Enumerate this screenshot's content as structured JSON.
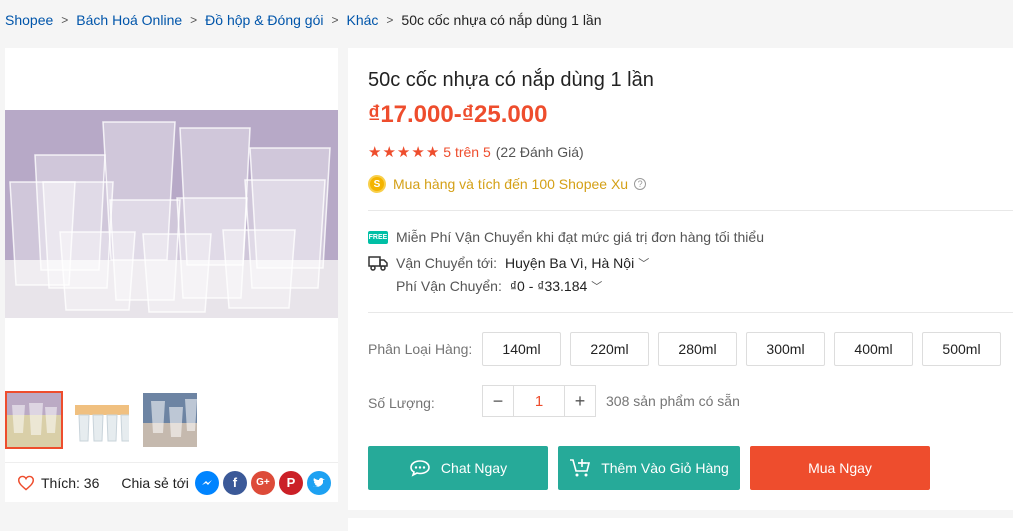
{
  "breadcrumb": {
    "items": [
      "Shopee",
      "Bách Hoá Online",
      "Đồ hộp & Đóng gói",
      "Khác"
    ],
    "current": "50c cốc nhựa có nắp dùng 1 lần"
  },
  "product": {
    "title": "50c cốc nhựa có nắp dùng 1 lần",
    "price": "₫17.000-₫25.000",
    "rating_text": "5 trên 5",
    "review_text": "(22 Đánh Giá)",
    "coins_text": "Mua hàng và tích đến 100 Shopee Xu"
  },
  "shipping": {
    "free_text": "Miễn Phí Vận Chuyển khi đạt mức giá trị đơn hàng tối thiểu",
    "to_label": "Vận Chuyển tới:",
    "to_value": "Huyện Ba Vì, Hà Nội",
    "fee_label": "Phí Vận Chuyển:",
    "fee_value": "₫0 - ₫33.184"
  },
  "variants": {
    "label": "Phân Loại Hàng:",
    "options": [
      "140ml",
      "220ml",
      "280ml",
      "300ml",
      "400ml",
      "500ml"
    ]
  },
  "quantity": {
    "label": "Số Lượng:",
    "value": "1",
    "minus": "−",
    "plus": "+",
    "stock": "308 sản phẩm có sẵn"
  },
  "actions": {
    "chat": "Chat Ngay",
    "cart": "Thêm Vào Giỏ Hàng",
    "buy": "Mua Ngay"
  },
  "social": {
    "like_label": "Thích: 36",
    "share_label": "Chia sẻ tới",
    "share_icons": [
      "messenger-icon",
      "facebook-icon",
      "google-plus-icon",
      "pinterest-icon",
      "twitter-icon"
    ]
  },
  "colors": {
    "accent": "#ee4d2d",
    "teal": "#26aa99",
    "link": "#0055aa"
  }
}
